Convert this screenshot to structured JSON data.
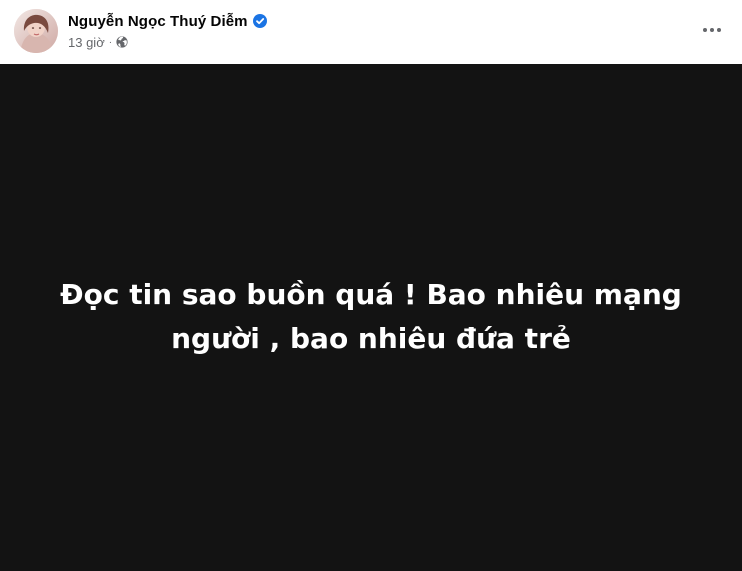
{
  "post": {
    "author_name": "Nguyễn Ngọc Thuý Diễm",
    "timestamp": "13 giờ",
    "separator": "·",
    "audience_icon": "globe-icon",
    "verified_icon": "verified-badge-icon",
    "more_icon": "more-horizontal-icon",
    "status_lines": [
      "Đọc tin sao buồn quá ! Bao nhiêu mạng",
      "người , bao nhiêu đứa trẻ"
    ]
  },
  "colors": {
    "status_background": "#131313",
    "status_text": "#ffffff",
    "verified_blue": "#1b74e4",
    "secondary_text": "#65676b"
  }
}
